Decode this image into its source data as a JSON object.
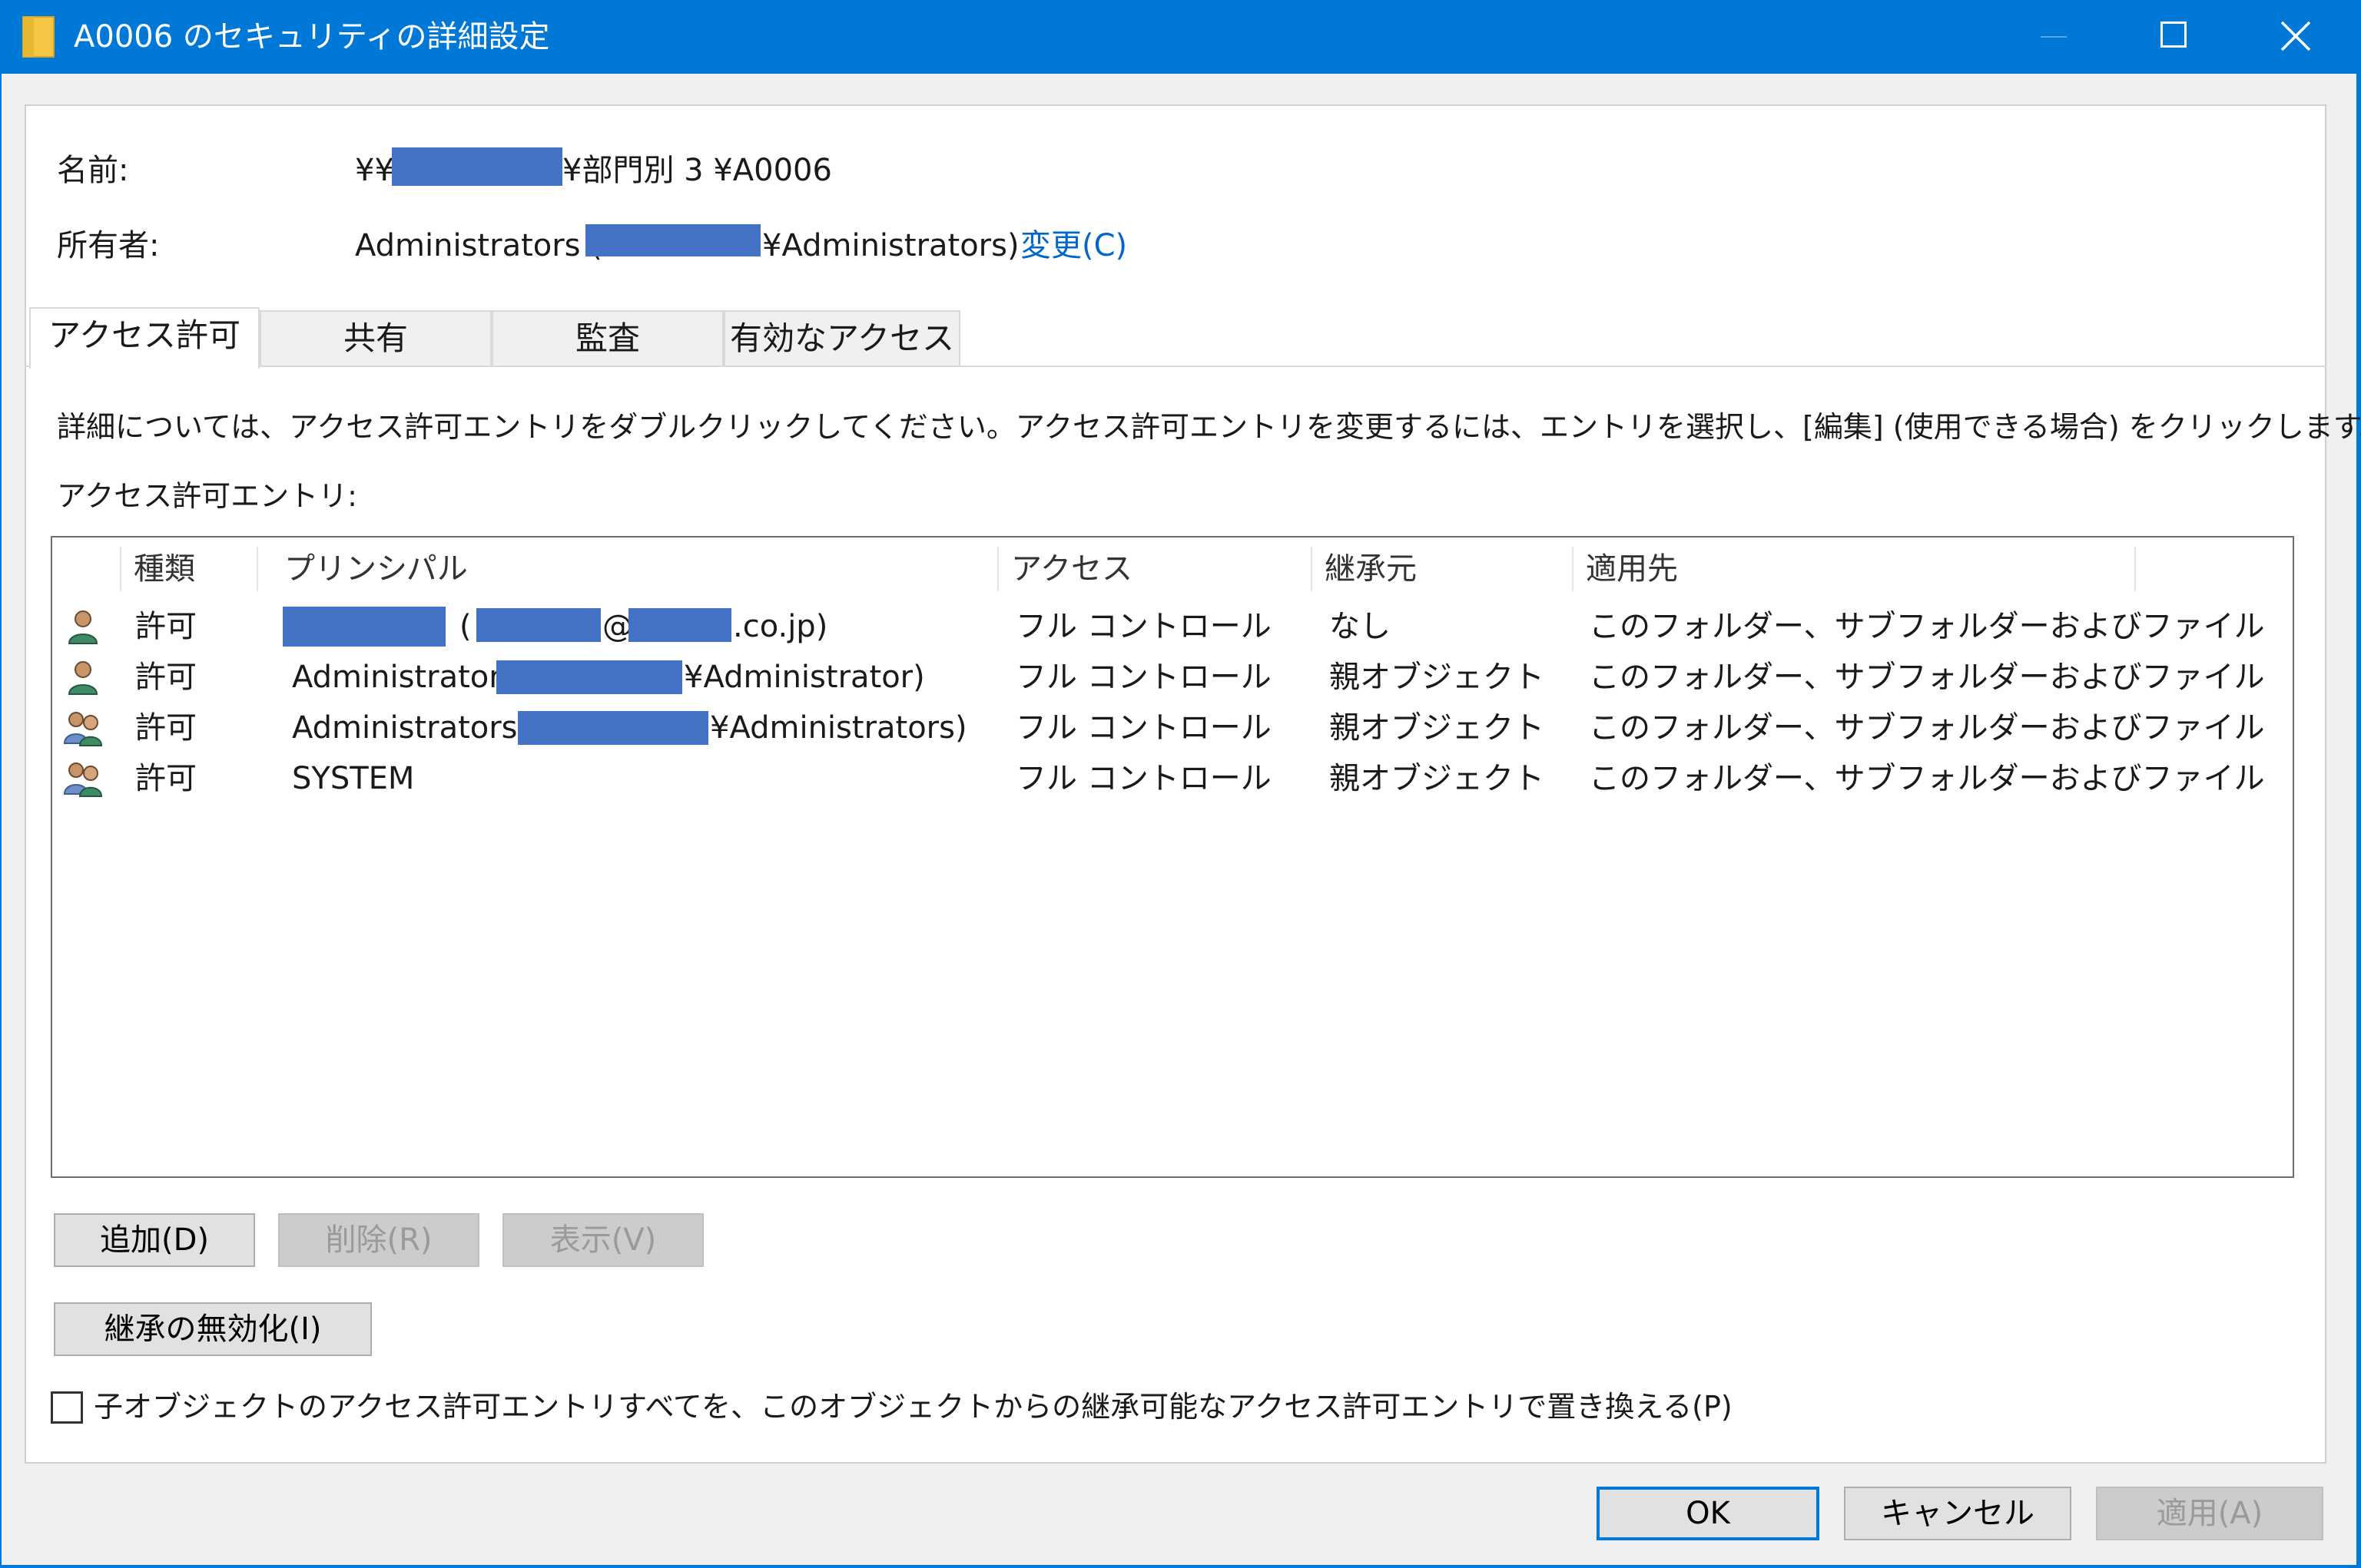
{
  "window": {
    "title": "A0006 のセキュリティの詳細設定",
    "accent_color": "#0078d7",
    "controls": [
      "minimize-icon",
      "maximize-icon",
      "close-icon"
    ]
  },
  "header": {
    "name_label": "名前:",
    "name_value_prefix": "¥¥",
    "name_value_suffix": "¥部門別 3 ¥A0006",
    "owner_label": "所有者:",
    "owner_value_prefix": "Administrators (",
    "owner_value_suffix": "¥Administrators)",
    "owner_change_link": "変更(C)"
  },
  "tabs": [
    {
      "label": "アクセス許可",
      "active": true
    },
    {
      "label": "共有",
      "active": false
    },
    {
      "label": "監査",
      "active": false
    },
    {
      "label": "有効なアクセス",
      "active": false
    }
  ],
  "instructions": "詳細については、アクセス許可エントリをダブルクリックしてください。アクセス許可エントリを変更するには、エントリを選択し、[編集] (使用できる場合) をクリックします。",
  "entries_label": "アクセス許可エントリ:",
  "table": {
    "columns": [
      "種類",
      "プリンシパル",
      "アクセス",
      "継承元",
      "適用先"
    ],
    "rows": [
      {
        "icon": "user-icon",
        "type": "許可",
        "principal_prefix": "",
        "principal_mid1": "(",
        "principal_mid2": "@",
        "principal_suffix": ".co.jp)",
        "access": "フル コントロール",
        "inherited_from": "なし",
        "applies_to": "このフォルダー、サブフォルダーおよびファイル"
      },
      {
        "icon": "user-icon",
        "type": "許可",
        "principal_prefix": "Administrator (",
        "principal_suffix": "¥Administrator)",
        "access": "フル コントロール",
        "inherited_from": "親オブジェクト",
        "applies_to": "このフォルダー、サブフォルダーおよびファイル"
      },
      {
        "icon": "group-icon",
        "type": "許可",
        "principal_prefix": "Administrators (",
        "principal_suffix": "¥Administrators)",
        "access": "フル コントロール",
        "inherited_from": "親オブジェクト",
        "applies_to": "このフォルダー、サブフォルダーおよびファイル"
      },
      {
        "icon": "group-icon",
        "type": "許可",
        "principal_prefix": "SYSTEM",
        "principal_suffix": "",
        "access": "フル コントロール",
        "inherited_from": "親オブジェクト",
        "applies_to": "このフォルダー、サブフォルダーおよびファイル"
      }
    ]
  },
  "buttons": {
    "add": "追加(D)",
    "remove": "削除(R)",
    "view": "表示(V)",
    "disable_inheritance": "継承の無効化(I)",
    "ok": "OK",
    "cancel": "キャンセル",
    "apply": "適用(A)"
  },
  "replace_checkbox": {
    "label": "子オブジェクトのアクセス許可エントリすべてを、このオブジェクトからの継承可能なアクセス許可エントリで置き換える(P)",
    "checked": false
  },
  "redaction_color": "#4472c4"
}
